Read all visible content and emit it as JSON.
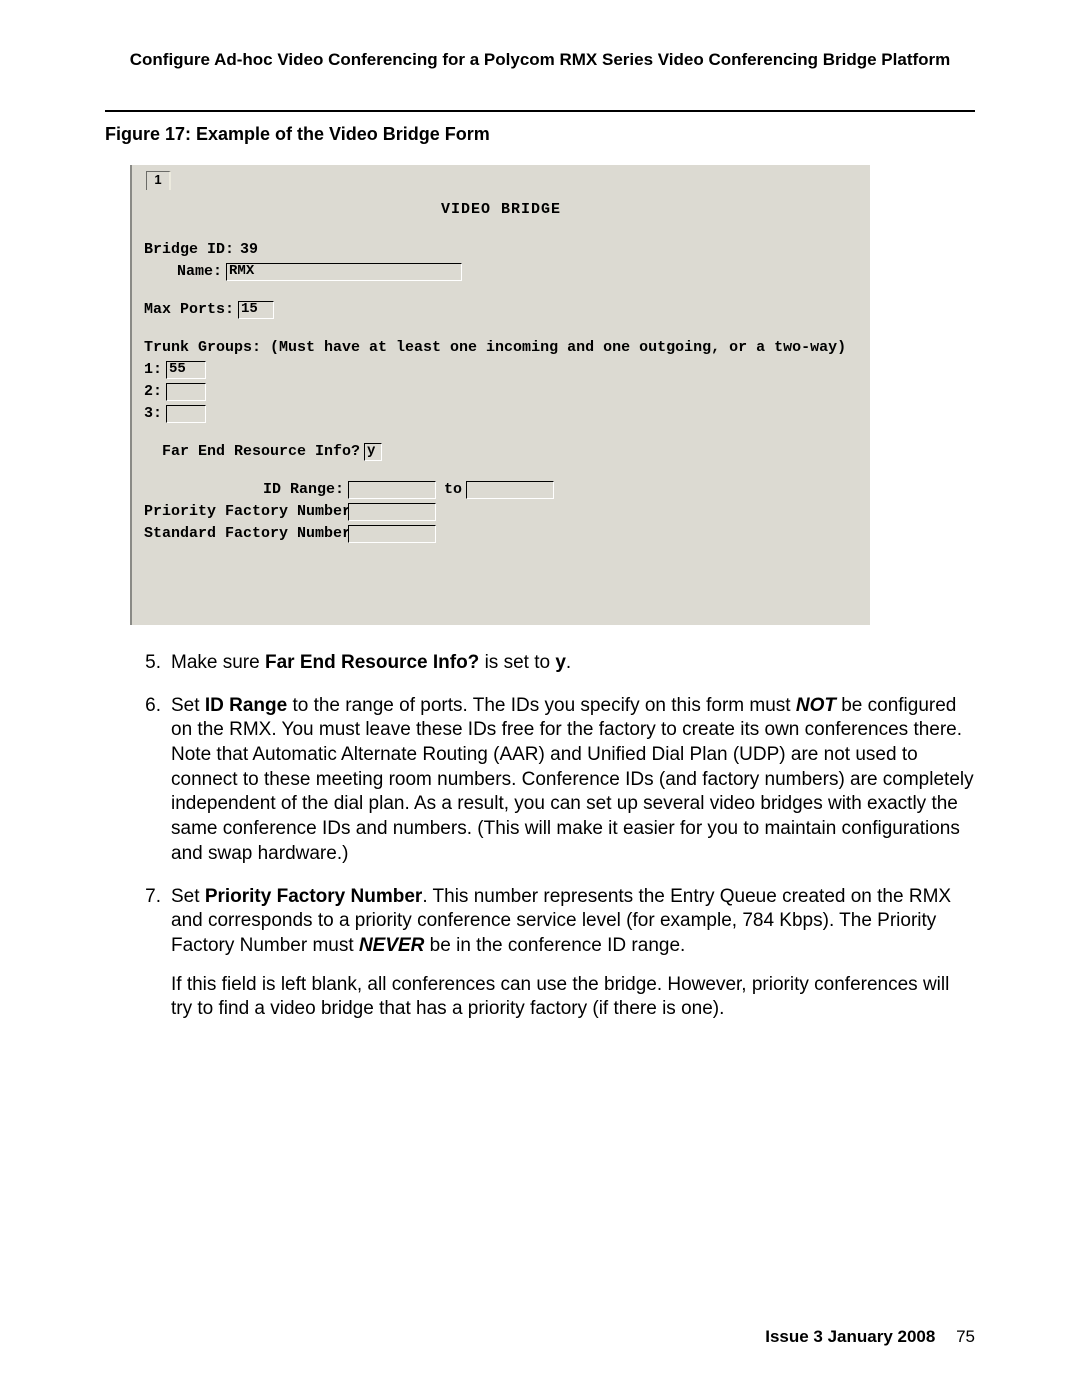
{
  "header": "Configure Ad-hoc Video Conferencing for a Polycom RMX Series Video Conferencing Bridge Platform",
  "figure_caption": "Figure 17: Example of the Video Bridge Form",
  "form": {
    "tab": "1",
    "title": "VIDEO BRIDGE",
    "bridge_id_label": "Bridge ID:",
    "bridge_id_value": "39",
    "name_label": "Name:",
    "name_value": "RMX",
    "max_ports_label": "Max Ports:",
    "max_ports_value": "15",
    "trunk_groups_label": "Trunk Groups: (Must have at least one incoming and one outgoing, or a two-way)",
    "trunk_row1_label": "1:",
    "trunk_row1_value": "55",
    "trunk_row2_label": "2:",
    "trunk_row2_value": "",
    "trunk_row3_label": "3:",
    "trunk_row3_value": "",
    "fer_label": "Far End Resource Info?",
    "fer_value": "y",
    "id_range_label": "ID Range:",
    "id_range_from": "",
    "id_range_to_label": "to",
    "id_range_to": "",
    "priority_label": "Priority Factory Number:",
    "priority_value": "",
    "standard_label": "Standard Factory Number:",
    "standard_value": ""
  },
  "steps": {
    "s5": {
      "num": "5.",
      "pre": "Make sure ",
      "bold1": "Far End Resource Info?",
      "mid": " is set to ",
      "bold2": "y",
      "post": "."
    },
    "s6": {
      "num": "6.",
      "pre": "Set ",
      "bold1": "ID Range",
      "mid1": " to the range of ports. The IDs you specify on this form must ",
      "boldital": "NOT",
      "mid2": " be configured on the RMX. You must leave these IDs free for the factory to create its own conferences there. Note that Automatic Alternate Routing (AAR) and Unified Dial Plan (UDP) are not used to connect to these meeting room numbers. Conference IDs (and factory numbers) are completely independent of the dial plan. As a result, you can set up several video bridges with exactly the same conference IDs and numbers. (This will make it easier for you to maintain configurations and swap hardware.)"
    },
    "s7": {
      "num": "7.",
      "pre": "Set ",
      "bold1": "Priority Factory Number",
      "mid1": ". This number represents the Entry Queue created on the RMX and corresponds to a priority conference service level (for example, 784 Kbps). The Priority Factory Number must ",
      "boldital": "NEVER",
      "mid2": " be in the conference ID range.",
      "p2": "If this field is left blank, all conferences can use the bridge. However, priority conferences will try to find a video bridge that has a priority factory (if there is one)."
    }
  },
  "footer": {
    "issue": "Issue 3   January 2008",
    "page": "75"
  }
}
